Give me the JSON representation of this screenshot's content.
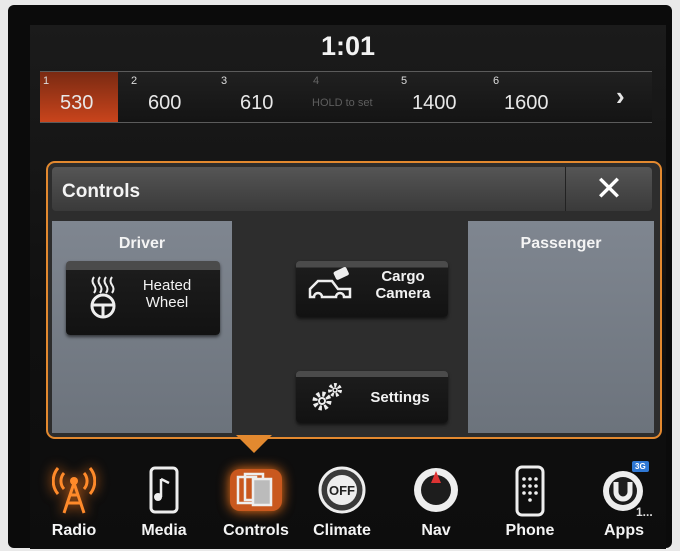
{
  "status": {
    "time": "1:01"
  },
  "presets": [
    {
      "num": "1",
      "freq": "530"
    },
    {
      "num": "2",
      "freq": "600"
    },
    {
      "num": "3",
      "freq": "610"
    },
    {
      "num": "4",
      "hint": "HOLD to set"
    },
    {
      "num": "5",
      "freq": "1400"
    },
    {
      "num": "6",
      "freq": "1600"
    }
  ],
  "presets_next": "›",
  "controls": {
    "title": "Controls",
    "close_label": "✕",
    "driver_title": "Driver",
    "passenger_title": "Passenger",
    "heated_wheel": "Heated\nWheel",
    "cargo_camera": "Cargo\nCamera",
    "settings": "Settings"
  },
  "dock": {
    "radio": "Radio",
    "media": "Media",
    "controls": "Controls",
    "climate": "Climate",
    "nav": "Nav",
    "phone": "Phone",
    "apps": "Apps",
    "apps_badge": "3G",
    "apps_more": "1...",
    "climate_off": "OFF"
  },
  "colors": {
    "accent": "#e3892f",
    "active_preset": "#c9441c"
  }
}
